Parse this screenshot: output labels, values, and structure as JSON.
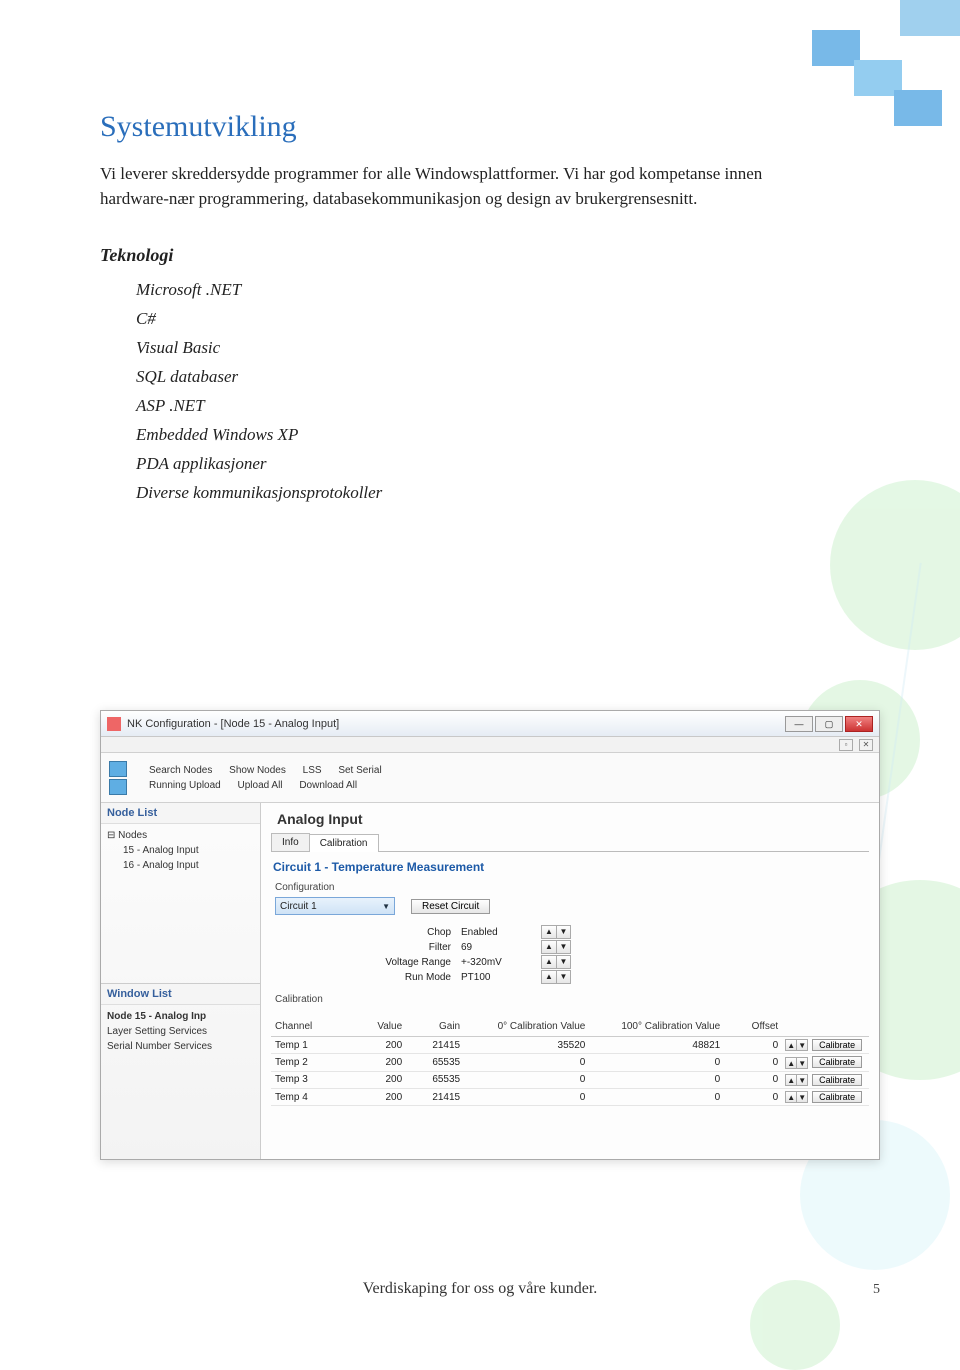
{
  "heading": "Systemutvikling",
  "paragraph": "Vi leverer skreddersydde programmer for alle Windowsplattformer. Vi har god kompetanse innen hardware-nær programmering, databasekommunikasjon og design av brukergrensesnitt.",
  "tech_heading": "Teknologi",
  "tech_items": [
    "Microsoft .NET",
    "C#",
    "Visual Basic",
    "SQL databaser",
    "ASP .NET",
    "Embedded Windows XP",
    "PDA applikasjoner",
    "Diverse kommunikasjonsprotokoller"
  ],
  "screenshot": {
    "window_title": "NK Configuration - [Node 15 - Analog Input]",
    "menu_row1": [
      "Search Nodes",
      "Show Nodes",
      "LSS",
      "Set Serial"
    ],
    "menu_row2": [
      "Running Upload",
      "Upload All",
      "Download All"
    ],
    "node_list_header": "Node List",
    "tree_root": "Nodes",
    "tree_children": [
      "15 - Analog Input",
      "16 - Analog Input"
    ],
    "window_list_header": "Window List",
    "window_list_items": [
      "Node 15 - Analog Inp",
      "Layer Setting Services",
      "Serial Number Services"
    ],
    "main_header": "Analog Input",
    "tabs": [
      "Info",
      "Calibration"
    ],
    "section_title": "Circuit 1 - Temperature Measurement",
    "config_label": "Configuration",
    "combo_value": "Circuit 1",
    "reset_button": "Reset Circuit",
    "params": [
      {
        "label": "Chop",
        "value": "Enabled"
      },
      {
        "label": "Filter",
        "value": "69"
      },
      {
        "label": "Voltage Range",
        "value": "+-320mV"
      },
      {
        "label": "Run Mode",
        "value": "PT100"
      }
    ],
    "calibration_label": "Calibration",
    "cal_headers": [
      "Channel",
      "Value",
      "Gain",
      "0° Calibration Value",
      "100° Calibration Value",
      "Offset",
      ""
    ],
    "cal_rows": [
      {
        "ch": "Temp 1",
        "val": "200",
        "gain": "21415",
        "zero": "35520",
        "hund": "48821",
        "off": "0"
      },
      {
        "ch": "Temp 2",
        "val": "200",
        "gain": "65535",
        "zero": "0",
        "hund": "0",
        "off": "0"
      },
      {
        "ch": "Temp 3",
        "val": "200",
        "gain": "65535",
        "zero": "0",
        "hund": "0",
        "off": "0"
      },
      {
        "ch": "Temp 4",
        "val": "200",
        "gain": "21415",
        "zero": "0",
        "hund": "0",
        "off": "0"
      }
    ],
    "calibrate_button": "Calibrate"
  },
  "footer": "Verdiskaping for oss og våre kunder.",
  "page_number": "5"
}
